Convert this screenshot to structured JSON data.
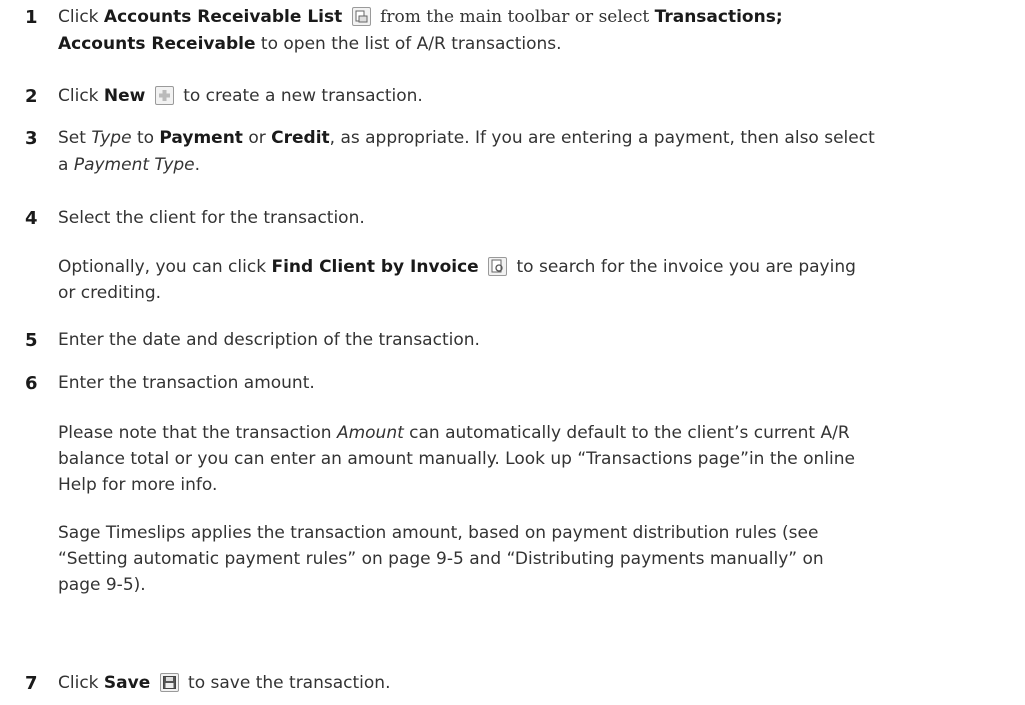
{
  "steps": [
    {
      "number": "1",
      "l1_a": "Click ",
      "l1_b": "Accounts Receivable List",
      "l1_icon": "accounts-receivable-list-icon",
      "l1_c": "from the main toolbar or select ",
      "l1_d": "Transactions;",
      "l2_a": "Accounts Receivable",
      "l2_b": " to open the list of A/R transactions."
    },
    {
      "number": "2",
      "l1_a": "Click ",
      "l1_b": "New",
      "l1_icon": "new-plus-icon",
      "l1_c": " to create a new transaction."
    },
    {
      "number": "3",
      "l1_a": "Set ",
      "l1_b": "Type",
      "l1_c": " to ",
      "l1_d": "Payment",
      "l1_e": " or ",
      "l1_f": "Credit",
      "l1_g": ", as appropriate. If you are entering a payment, then also select",
      "l2_a": "a ",
      "l2_b": "Payment Type",
      "l2_c": "."
    },
    {
      "number": "4",
      "l1": "Select the client for the transaction.",
      "p2_a": "Optionally, you can click ",
      "p2_b": "Find Client by Invoice",
      "p2_icon": "find-client-by-invoice-icon",
      "p2_c": " to search for the invoice you are paying",
      "p2_l2": "or crediting."
    },
    {
      "number": "5",
      "l1": "Enter the date and description of the transaction."
    },
    {
      "number": "6",
      "l1": "Enter the transaction amount.",
      "p2_a": "Please note that the transaction ",
      "p2_b": "Amount",
      "p2_c": " can automatically default to the client’s current A/R",
      "p2_l2": "balance total or you can enter an amount  manually. Look up “Transactions page”in the online",
      "p2_l3": "Help for more info.",
      "p3_l1": "Sage Timeslips applies the transaction amount, based on payment distribution rules (see",
      "p3_l2": "“Setting automatic payment rules” on page 9-5 and “Distributing payments manually” on",
      "p3_l3": "page 9-5)."
    },
    {
      "number": "7",
      "l1_a": "Click ",
      "l1_b": "Save",
      "l1_icon": "save-disk-icon",
      "l1_c": " to save the transaction."
    }
  ]
}
